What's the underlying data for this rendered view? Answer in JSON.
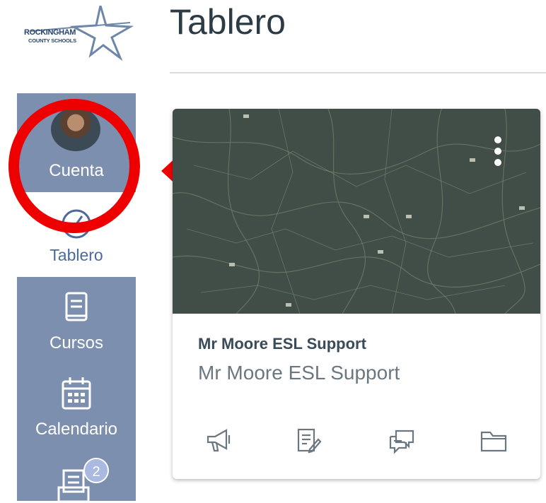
{
  "logo": {
    "line1": "ROCKINGHAM",
    "line2": "COUNTY SCHOOLS"
  },
  "header": {
    "title": "Tablero"
  },
  "nav": {
    "account_label": "Cuenta",
    "dashboard_label": "Tablero",
    "courses_label": "Cursos",
    "calendar_label": "Calendario",
    "inbox_badge": "2"
  },
  "card": {
    "title": "Mr Moore ESL Support",
    "subtitle": "Mr Moore ESL Support",
    "icons": [
      "announcements-icon",
      "assignments-icon",
      "discussions-icon",
      "files-icon"
    ]
  },
  "colors": {
    "nav_bg": "#7d8fae",
    "annotation_red": "#ee0000",
    "heading": "#2d3b45"
  }
}
